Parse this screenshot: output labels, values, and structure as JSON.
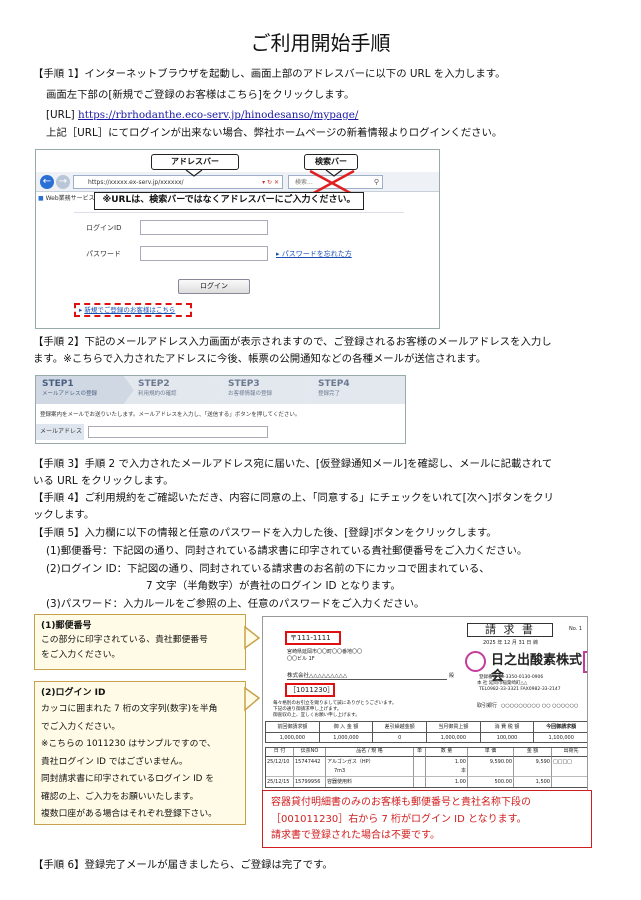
{
  "title": "ご利用開始手順",
  "step1": {
    "line1": "【手順 1】インターネットブラウザを起動し、画面上部のアドレスバーに以下の URL を入力します。",
    "line2": "画面左下部の[新規でご登録のお客様はこちら]をクリックします。",
    "url_label": "[URL]",
    "url": "https://rbrhodanthe.eco-serv.jp/hinodesanso/mypage/",
    "line4": "上記［URL］にてログインが出来ない場合、弊社ホームページの新着情報よりログインください。"
  },
  "browser": {
    "address_callout": "アドレスバー",
    "search_callout": "検索バー",
    "address_text": "https://xxxxx.ex-serv.jp/xxxxxx/",
    "search_placeholder": "検索...",
    "tab_label": "Web業務サービス",
    "notice": "※URLは、検索バーではなくアドレスバーにご入力ください。",
    "login_id_label": "ログインID",
    "password_label": "パスワード",
    "forgot_link": "パスワードを忘れた方",
    "login_button": "ログイン",
    "new_user_link": "新規でご登録のお客様はこちら"
  },
  "step2": {
    "line1": "【手順 2】下記のメールアドレス入力画面が表示されますので、ご登録されるお客様のメールアドレスを入力し",
    "line2": "ます。※こちらで入力されたアドレスに今後、帳票の公開通知などの各種メールが送信されます。"
  },
  "wizard": {
    "steps": [
      {
        "num": "STEP1",
        "label": "メールアドレスの登録"
      },
      {
        "num": "STEP2",
        "label": "利用規約の確認"
      },
      {
        "num": "STEP3",
        "label": "お客様情報の登録"
      },
      {
        "num": "STEP4",
        "label": "登録完了"
      }
    ],
    "instruction": "登録案内をメールでお送りいたします。メールアドレスを入力し、「送信する」ボタンを押してください。",
    "email_label": "メールアドレス"
  },
  "step3": {
    "line1": "【手順 3】手順 2 で入力されたメールアドレス宛に届いた、[仮登録通知メール]を確認し、メールに記載されて",
    "line2": "いる URL をクリックします。"
  },
  "step4": {
    "line1": "【手順 4】ご利用規約をご確認いただき、内容に同意の上、「同意する」にチェックをいれて[次へ]ボタンをクリ",
    "line2": "ックします。"
  },
  "step5": {
    "line1": "【手順 5】入力欄に以下の情報と任意のパスワードを入力した後、[登録]ボタンをクリックします。",
    "item1": "(1)郵便番号：下記図の通り、同封されている請求書に印字されている貴社郵便番号をご入力ください。",
    "item2a": "(2)ログイン ID：下記図の通り、同封されている請求書のお名前の下にカッコで囲まれている、",
    "item2b": "7 文字（半角数字）が貴社のログイン ID となります。",
    "item3": "(3)パスワード：入力ルールをご参照の上、任意のパスワードをご入力ください。"
  },
  "callout_postal": {
    "title": "(1)郵便番号",
    "line1": "この部分に印字されている、貴社郵便番号",
    "line2": "をご入力ください。"
  },
  "callout_login": {
    "title": "(2)ログイン ID",
    "lines": [
      "カッコに囲まれた 7 桁の文字列(数字)を半角",
      "でご入力ください。",
      "※こちらの 1011230 はサンプルですので、",
      "貴社ログイン ID ではございません。",
      "同封請求書に印字されているログイン ID を",
      "確認の上、ご入力をお願いいたします。",
      "複数口座がある場合はそれぞれ登録下さい。"
    ]
  },
  "invoice": {
    "title": "請 求 書",
    "no": "No. 1",
    "postal": "〒111-1111",
    "addr1": "宮崎県延岡市〇〇町〇〇番地〇〇",
    "addr2": "〇〇ビル 1F",
    "date": "2025 年 12 月 31 日 締",
    "company": "日之出酸素株式会",
    "customer": "株式会社△△△△△△△△△",
    "honorific": "殿",
    "login_id": "［1011230］",
    "greeting1": "毎々格別のお引立を賜りまして誠にありがとうございます。",
    "greeting2": "下記の通り御請求申し上げます。",
    "greeting3": "御査収の上、宜しくお願い申し上げます。",
    "bank": "取引銀行",
    "bank_accounts": "○○○○○○○○○ ○○ ○○○○○○",
    "reg": "登録番号 T3-3350-0130-0906",
    "head_office": "本 社 延岡市稲葉崎町△△",
    "tel": "TEL0982-33-3321 FAX0982-33-2147",
    "summary_headers": [
      "前回御請求額",
      "御 入 金 額",
      "差引繰越金額",
      "当月御買上額",
      "消 費 税 額",
      "今回御請求額"
    ],
    "summary_values": [
      "1,000,000",
      "1,000,000",
      "0",
      "1,000,000",
      "100,000",
      "1,100,000"
    ],
    "line_headers": [
      "日 付",
      "伝票NO",
      "品名 / 規 格",
      "単",
      "数 量",
      "単 価",
      "金 額",
      "出荷先"
    ],
    "rows": [
      [
        "25/12/10",
        "15747442",
        "アルゴンガス（HP）",
        "",
        "1.00",
        "9,590.00",
        "9,590",
        "□□□□"
      ],
      [
        "",
        "",
        "7m3",
        "",
        "本",
        "",
        "",
        ""
      ],
      [
        "25/12/15",
        "15799956",
        "容器使用料",
        "",
        "1.00",
        "500.00",
        "1,500",
        ""
      ]
    ]
  },
  "red_note": {
    "line1": "容器貸付明細書のみのお客様も郵便番号と貴社名称下段の",
    "line2": "［001011230］右から 7 桁がログイン ID となります。",
    "line3": "請求書で登録された場合は不要です。"
  },
  "step6": {
    "line1": "【手順 6】登録完了メールが届きましたら、ご登録は完了です。"
  },
  "colors": {
    "red": "#d21e1e",
    "callout_border": "#c8a24a",
    "callout_bg": "#fffbe6",
    "link": "#1a1aa6"
  }
}
